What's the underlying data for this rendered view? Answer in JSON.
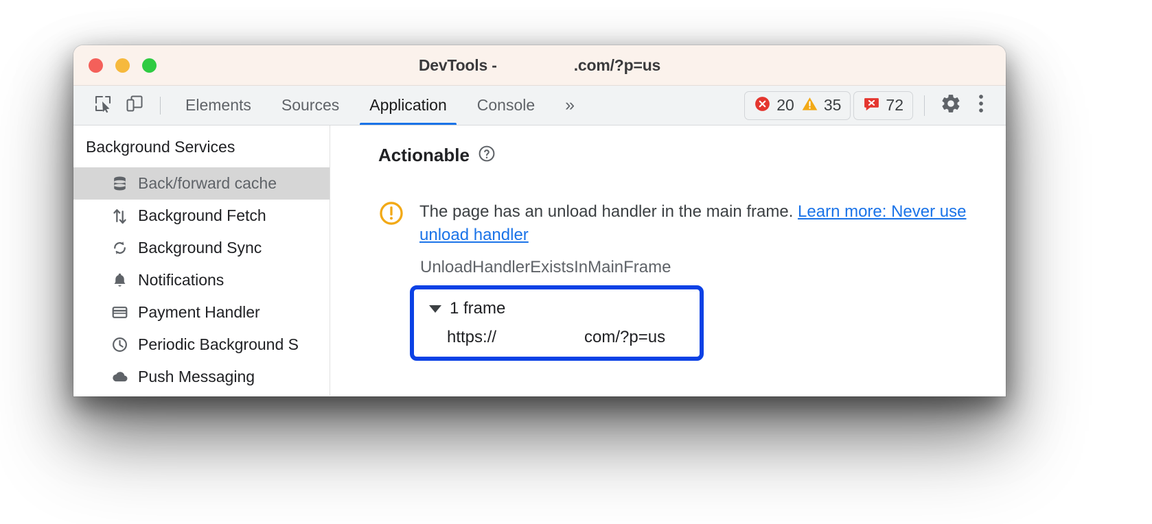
{
  "window": {
    "title_prefix": "DevTools -",
    "title_suffix": ".com/?p=us",
    "traffic_lights": {
      "close": "close-window-button",
      "minimize": "minimize-window-button",
      "maximize": "maximize-window-button"
    }
  },
  "toolbar": {
    "inspect_icon": "inspect-element-icon",
    "device_icon": "device-toolbar-icon",
    "tabs": [
      {
        "label": "Elements",
        "selected": false
      },
      {
        "label": "Sources",
        "selected": false
      },
      {
        "label": "Application",
        "selected": true
      },
      {
        "label": "Console",
        "selected": false
      }
    ],
    "more_tabs": "»",
    "counters": {
      "errors": "20",
      "warnings": "35",
      "issues": "72"
    },
    "settings_icon": "gear-icon",
    "more_options_icon": "kebab-menu-icon"
  },
  "sidebar": {
    "title": "Background Services",
    "items": [
      {
        "label": "Back/forward cache",
        "icon": "database-icon",
        "selected": true
      },
      {
        "label": "Background Fetch",
        "icon": "arrows-up-down-icon",
        "selected": false
      },
      {
        "label": "Background Sync",
        "icon": "sync-icon",
        "selected": false
      },
      {
        "label": "Notifications",
        "icon": "bell-icon",
        "selected": false
      },
      {
        "label": "Payment Handler",
        "icon": "credit-card-icon",
        "selected": false
      },
      {
        "label": "Periodic Background S",
        "icon": "clock-icon",
        "selected": false
      },
      {
        "label": "Push Messaging",
        "icon": "cloud-icon",
        "selected": false
      }
    ]
  },
  "main": {
    "section_title": "Actionable",
    "help_icon": "help-question-icon",
    "issue": {
      "status_icon": "warning-exclamation-circle-icon",
      "message": "The page has an unload handler in the main frame.",
      "link_text": "Learn more: Never use unload handler",
      "reason_code": "UnloadHandlerExistsInMainFrame"
    },
    "frame_box": {
      "expander_icon": "triangle-down-icon",
      "frame_count_label": "1 frame",
      "url_prefix": "https://",
      "url_suffix": "com/?p=us",
      "highlight_color": "#0b41e5"
    }
  },
  "colors": {
    "accent": "#1a73e8",
    "error": "#e4362f",
    "warning": "#f2a916",
    "issue": "#e4362f",
    "highlight": "#0b41e5",
    "titlebar_bg": "#fbf2ec",
    "toolbar_bg": "#f1f3f4",
    "sidebar_selected_bg": "#d6d6d6"
  }
}
